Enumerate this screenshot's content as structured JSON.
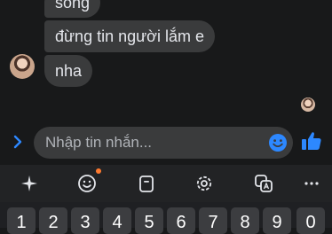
{
  "messages": [
    {
      "text": "sống"
    },
    {
      "text": "đừng tin người lắm e"
    },
    {
      "text": "nha"
    }
  ],
  "composer": {
    "placeholder": "Nhập tin nhắn..."
  },
  "colors": {
    "accent": "#2d88ff",
    "bubble": "#3a3b3c",
    "background": "#18191a",
    "notification_dot": "#ff7a2f"
  },
  "toolbar": {
    "icons": [
      "sparkle-icon",
      "sticker-icon",
      "clipboard-icon",
      "settings-icon",
      "translate-icon",
      "more-icon"
    ]
  },
  "keyboard": {
    "number_row": [
      "1",
      "2",
      "3",
      "4",
      "5",
      "6",
      "7",
      "8",
      "9",
      "0"
    ]
  }
}
